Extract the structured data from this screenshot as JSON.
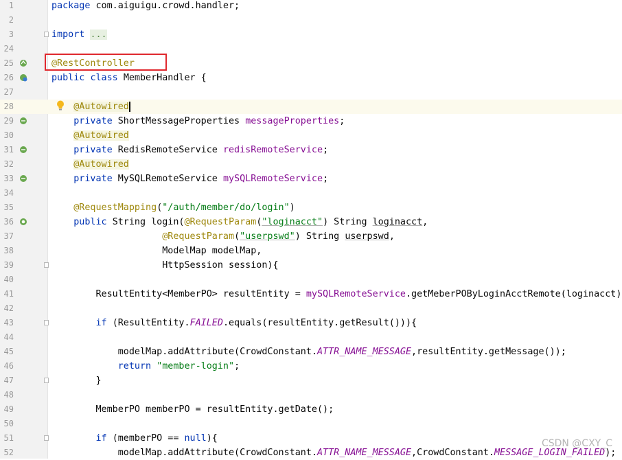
{
  "editor": {
    "lines": [
      {
        "num": "1",
        "tokens": [
          {
            "t": "package ",
            "c": "kw"
          },
          {
            "t": "com.aiguigu.crowd.handler;",
            "c": ""
          }
        ]
      },
      {
        "num": "2",
        "tokens": []
      },
      {
        "num": "3",
        "fold": true,
        "tokens": [
          {
            "t": "import ",
            "c": "kw"
          },
          {
            "t": "...",
            "c": "fold-text"
          }
        ]
      },
      {
        "num": "24",
        "tokens": []
      },
      {
        "num": "25",
        "marker": "bean",
        "tokens": [
          {
            "t": "@RestController",
            "c": "ann"
          }
        ]
      },
      {
        "num": "26",
        "marker": "class",
        "tokens": [
          {
            "t": "public ",
            "c": "kw"
          },
          {
            "t": "class ",
            "c": "kw"
          },
          {
            "t": "MemberHandler {",
            "c": ""
          }
        ]
      },
      {
        "num": "27",
        "tokens": []
      },
      {
        "num": "28",
        "current": true,
        "tokens": [
          {
            "t": "    ",
            "c": ""
          },
          {
            "t": "@Autowired",
            "c": "ann-bg caret-cell"
          }
        ]
      },
      {
        "num": "29",
        "marker": "inject",
        "tokens": [
          {
            "t": "    ",
            "c": ""
          },
          {
            "t": "private ",
            "c": "kw"
          },
          {
            "t": "ShortMessageProperties ",
            "c": ""
          },
          {
            "t": "messageProperties",
            "c": "field"
          },
          {
            "t": ";",
            "c": ""
          }
        ]
      },
      {
        "num": "30",
        "tokens": [
          {
            "t": "    ",
            "c": ""
          },
          {
            "t": "@Autowired",
            "c": "ann-bg"
          }
        ]
      },
      {
        "num": "31",
        "marker": "inject",
        "tokens": [
          {
            "t": "    ",
            "c": ""
          },
          {
            "t": "private ",
            "c": "kw"
          },
          {
            "t": "RedisRemoteService ",
            "c": ""
          },
          {
            "t": "redisRemoteService",
            "c": "field"
          },
          {
            "t": ";",
            "c": ""
          }
        ]
      },
      {
        "num": "32",
        "tokens": [
          {
            "t": "    ",
            "c": ""
          },
          {
            "t": "@Autowired",
            "c": "ann-bg"
          }
        ]
      },
      {
        "num": "33",
        "marker": "inject",
        "tokens": [
          {
            "t": "    ",
            "c": ""
          },
          {
            "t": "private ",
            "c": "kw"
          },
          {
            "t": "MySQLRemoteService ",
            "c": ""
          },
          {
            "t": "mySQLRemoteService",
            "c": "field"
          },
          {
            "t": ";",
            "c": ""
          }
        ]
      },
      {
        "num": "34",
        "tokens": []
      },
      {
        "num": "35",
        "tokens": [
          {
            "t": "    ",
            "c": ""
          },
          {
            "t": "@RequestMapping",
            "c": "ann"
          },
          {
            "t": "(",
            "c": ""
          },
          {
            "t": "\"/auth/member/do/login\"",
            "c": "str"
          },
          {
            "t": ")",
            "c": ""
          }
        ]
      },
      {
        "num": "36",
        "marker": "web",
        "tokens": [
          {
            "t": "    ",
            "c": ""
          },
          {
            "t": "public ",
            "c": "kw"
          },
          {
            "t": "String login(",
            "c": ""
          },
          {
            "t": "@RequestParam",
            "c": "ann"
          },
          {
            "t": "(",
            "c": ""
          },
          {
            "t": "\"loginacct\"",
            "c": "str ul"
          },
          {
            "t": ") String ",
            "c": ""
          },
          {
            "t": "loginacct",
            "c": "ul"
          },
          {
            "t": ",",
            "c": ""
          }
        ]
      },
      {
        "num": "37",
        "tokens": [
          {
            "t": "                    ",
            "c": ""
          },
          {
            "t": "@RequestParam",
            "c": "ann"
          },
          {
            "t": "(",
            "c": ""
          },
          {
            "t": "\"userpswd\"",
            "c": "str ul"
          },
          {
            "t": ") String ",
            "c": ""
          },
          {
            "t": "userpswd",
            "c": "ul"
          },
          {
            "t": ",",
            "c": ""
          }
        ]
      },
      {
        "num": "38",
        "tokens": [
          {
            "t": "                    ModelMap modelMap,",
            "c": ""
          }
        ]
      },
      {
        "num": "39",
        "fold": true,
        "tokens": [
          {
            "t": "                    HttpSession session){",
            "c": ""
          }
        ]
      },
      {
        "num": "40",
        "tokens": []
      },
      {
        "num": "41",
        "tokens": [
          {
            "t": "        ResultEntity<MemberPO> resultEntity = ",
            "c": ""
          },
          {
            "t": "mySQLRemoteService",
            "c": "field"
          },
          {
            "t": ".getMeberPOByLoginAcctRemote(loginacct);",
            "c": ""
          }
        ]
      },
      {
        "num": "42",
        "tokens": []
      },
      {
        "num": "43",
        "fold": true,
        "tokens": [
          {
            "t": "        ",
            "c": ""
          },
          {
            "t": "if ",
            "c": "kw"
          },
          {
            "t": "(ResultEntity.",
            "c": ""
          },
          {
            "t": "FAILED",
            "c": "const"
          },
          {
            "t": ".equals(resultEntity.getResult())){",
            "c": ""
          }
        ]
      },
      {
        "num": "44",
        "tokens": []
      },
      {
        "num": "45",
        "tokens": [
          {
            "t": "            modelMap.addAttribute(CrowdConstant.",
            "c": ""
          },
          {
            "t": "ATTR_NAME_MESSAGE",
            "c": "const"
          },
          {
            "t": ",resultEntity.getMessage());",
            "c": ""
          }
        ]
      },
      {
        "num": "46",
        "tokens": [
          {
            "t": "            ",
            "c": ""
          },
          {
            "t": "return ",
            "c": "kw"
          },
          {
            "t": "\"member-login\"",
            "c": "str"
          },
          {
            "t": ";",
            "c": ""
          }
        ]
      },
      {
        "num": "47",
        "fold": true,
        "tokens": [
          {
            "t": "        }",
            "c": ""
          }
        ]
      },
      {
        "num": "48",
        "tokens": []
      },
      {
        "num": "49",
        "tokens": [
          {
            "t": "        MemberPO memberPO = resultEntity.getDate();",
            "c": ""
          }
        ]
      },
      {
        "num": "50",
        "tokens": []
      },
      {
        "num": "51",
        "fold": true,
        "tokens": [
          {
            "t": "        ",
            "c": ""
          },
          {
            "t": "if ",
            "c": "kw"
          },
          {
            "t": "(memberPO == ",
            "c": ""
          },
          {
            "t": "null",
            "c": "kw"
          },
          {
            "t": "){",
            "c": ""
          }
        ]
      },
      {
        "num": "52",
        "tokens": [
          {
            "t": "            modelMap.addAttribute(CrowdConstant.",
            "c": ""
          },
          {
            "t": "ATTR_NAME_MESSAGE",
            "c": "const"
          },
          {
            "t": ",CrowdConstant.",
            "c": ""
          },
          {
            "t": "MESSAGE_LOGIN_FAILED",
            "c": "const"
          },
          {
            "t": ");",
            "c": ""
          }
        ]
      }
    ]
  },
  "watermark": "CSDN @CXY_C",
  "colors": {
    "keyword": "#0033b3",
    "annotation": "#9e880d",
    "string": "#067d17",
    "field": "#871094",
    "highlight_box": "#e0282e",
    "gutter": "#f2f2f2"
  }
}
